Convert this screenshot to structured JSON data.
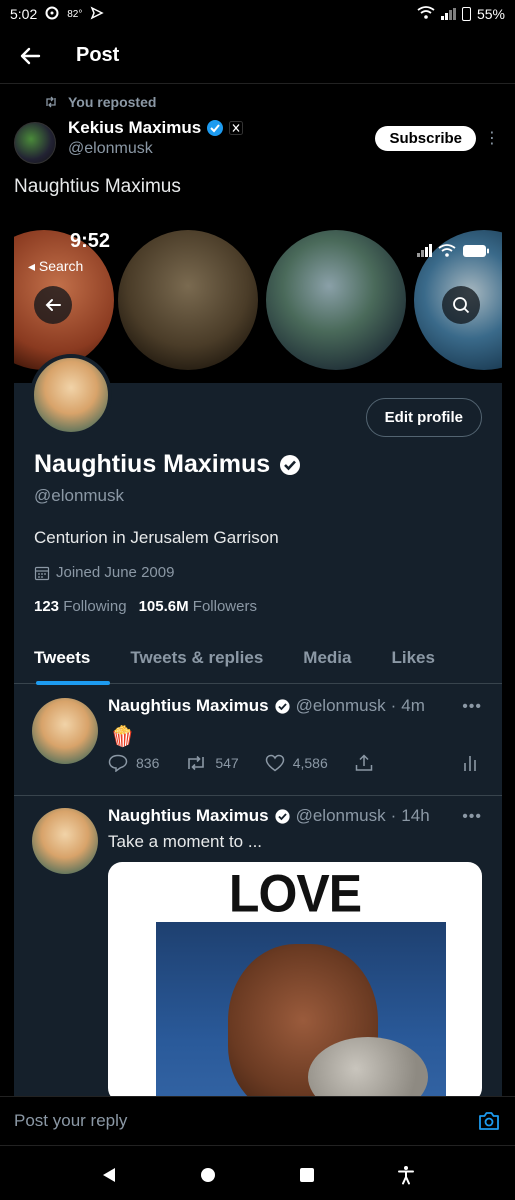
{
  "status_bar": {
    "time": "5:02",
    "temperature": "82°",
    "battery": "55%"
  },
  "header": {
    "title": "Post"
  },
  "post": {
    "repost_context": "You reposted",
    "author_name": "Kekius Maximus",
    "author_handle": "@elonmusk",
    "subscribe_label": "Subscribe",
    "text": "Naughtius Maximus"
  },
  "embedded_profile": {
    "inner_time": "9:52",
    "inner_back_label": "Search",
    "edit_profile_label": "Edit profile",
    "name": "Naughtius Maximus",
    "handle": "@elonmusk",
    "bio": "Centurion in Jerusalem Garrison",
    "joined": "Joined June 2009",
    "following_count": "123",
    "following_label": "Following",
    "followers_count": "105.6M",
    "followers_label": "Followers",
    "tabs": [
      {
        "label": "Tweets",
        "active": true
      },
      {
        "label": "Tweets & replies",
        "active": false
      },
      {
        "label": "Media",
        "active": false
      },
      {
        "label": "Likes",
        "active": false
      }
    ],
    "tweets": [
      {
        "name": "Naughtius Maximus",
        "handle": "@elonmusk",
        "time": "4m",
        "emoji": "🍿",
        "replies": "836",
        "retweets": "547",
        "likes": "4,586"
      },
      {
        "name": "Naughtius Maximus",
        "handle": "@elonmusk",
        "time": "14h",
        "text": "Take a moment to ...",
        "image_caption": "LOVE YOURSELF"
      }
    ]
  },
  "reply": {
    "placeholder": "Post your reply"
  },
  "colors": {
    "background": "#000000",
    "accent": "#1d9bf0",
    "embedded_background": "#15202b",
    "secondary_text": "#8b98a5"
  }
}
